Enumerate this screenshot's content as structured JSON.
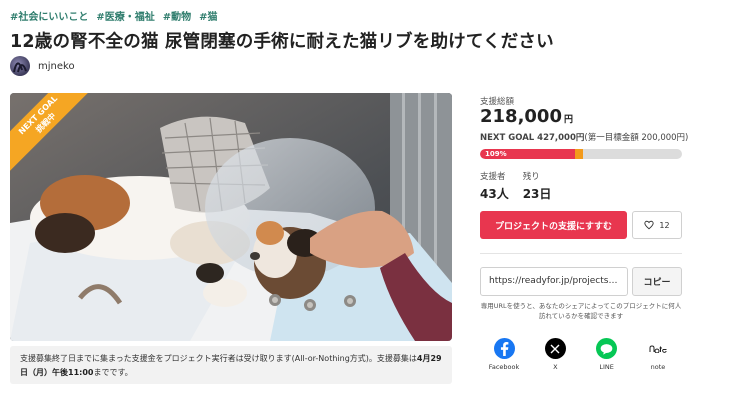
{
  "tags": [
    "#社会にいいこと",
    "#医療・福祉",
    "#動物",
    "#猫"
  ],
  "title": "12歳の腎不全の猫 尿管閉塞の手術に耐えた猫リブを助けてください",
  "author": {
    "name": "mjneko"
  },
  "ribbon": {
    "line1": "NEXT GOAL",
    "line2": "挑戦中"
  },
  "notice": {
    "text1": "支援募集終了日までに集まった支援金をプロジェクト実行者は受け取ります(All-or-Nothing方式)。支援募集は",
    "deadline": "4月29日（月）午後11:00",
    "text2": "までです。"
  },
  "funding": {
    "total_label": "支援総額",
    "amount": "218,000",
    "unit": "円",
    "next_goal": "NEXT GOAL 427,000円",
    "first_goal": "(第一目標金額 200,000円)",
    "progress_text": "109%",
    "progress_fraction": 0.51,
    "first_goal_fraction": 0.468
  },
  "stats": {
    "supporters_label": "支援者",
    "supporters_value": "43人",
    "remaining_label": "残り",
    "remaining_value": "23日"
  },
  "actions": {
    "support_label": "プロジェクトの支援にすすむ",
    "favorite_count": "12"
  },
  "share_url": {
    "value": "https://readyfor.jp/projects/r...",
    "copy_label": "コピー",
    "note": "専用URLを使うと、あなたのシェアによってこのプロジェクトに何人訪れているかを確認できます"
  },
  "shares": [
    {
      "name": "Facebook",
      "icon": "facebook-icon",
      "color": "#1877f2"
    },
    {
      "name": "X",
      "icon": "x-icon",
      "color": "#000000"
    },
    {
      "name": "LINE",
      "icon": "line-icon",
      "color": "#06c755"
    },
    {
      "name": "note",
      "icon": "note-icon",
      "color": "#222222"
    }
  ]
}
